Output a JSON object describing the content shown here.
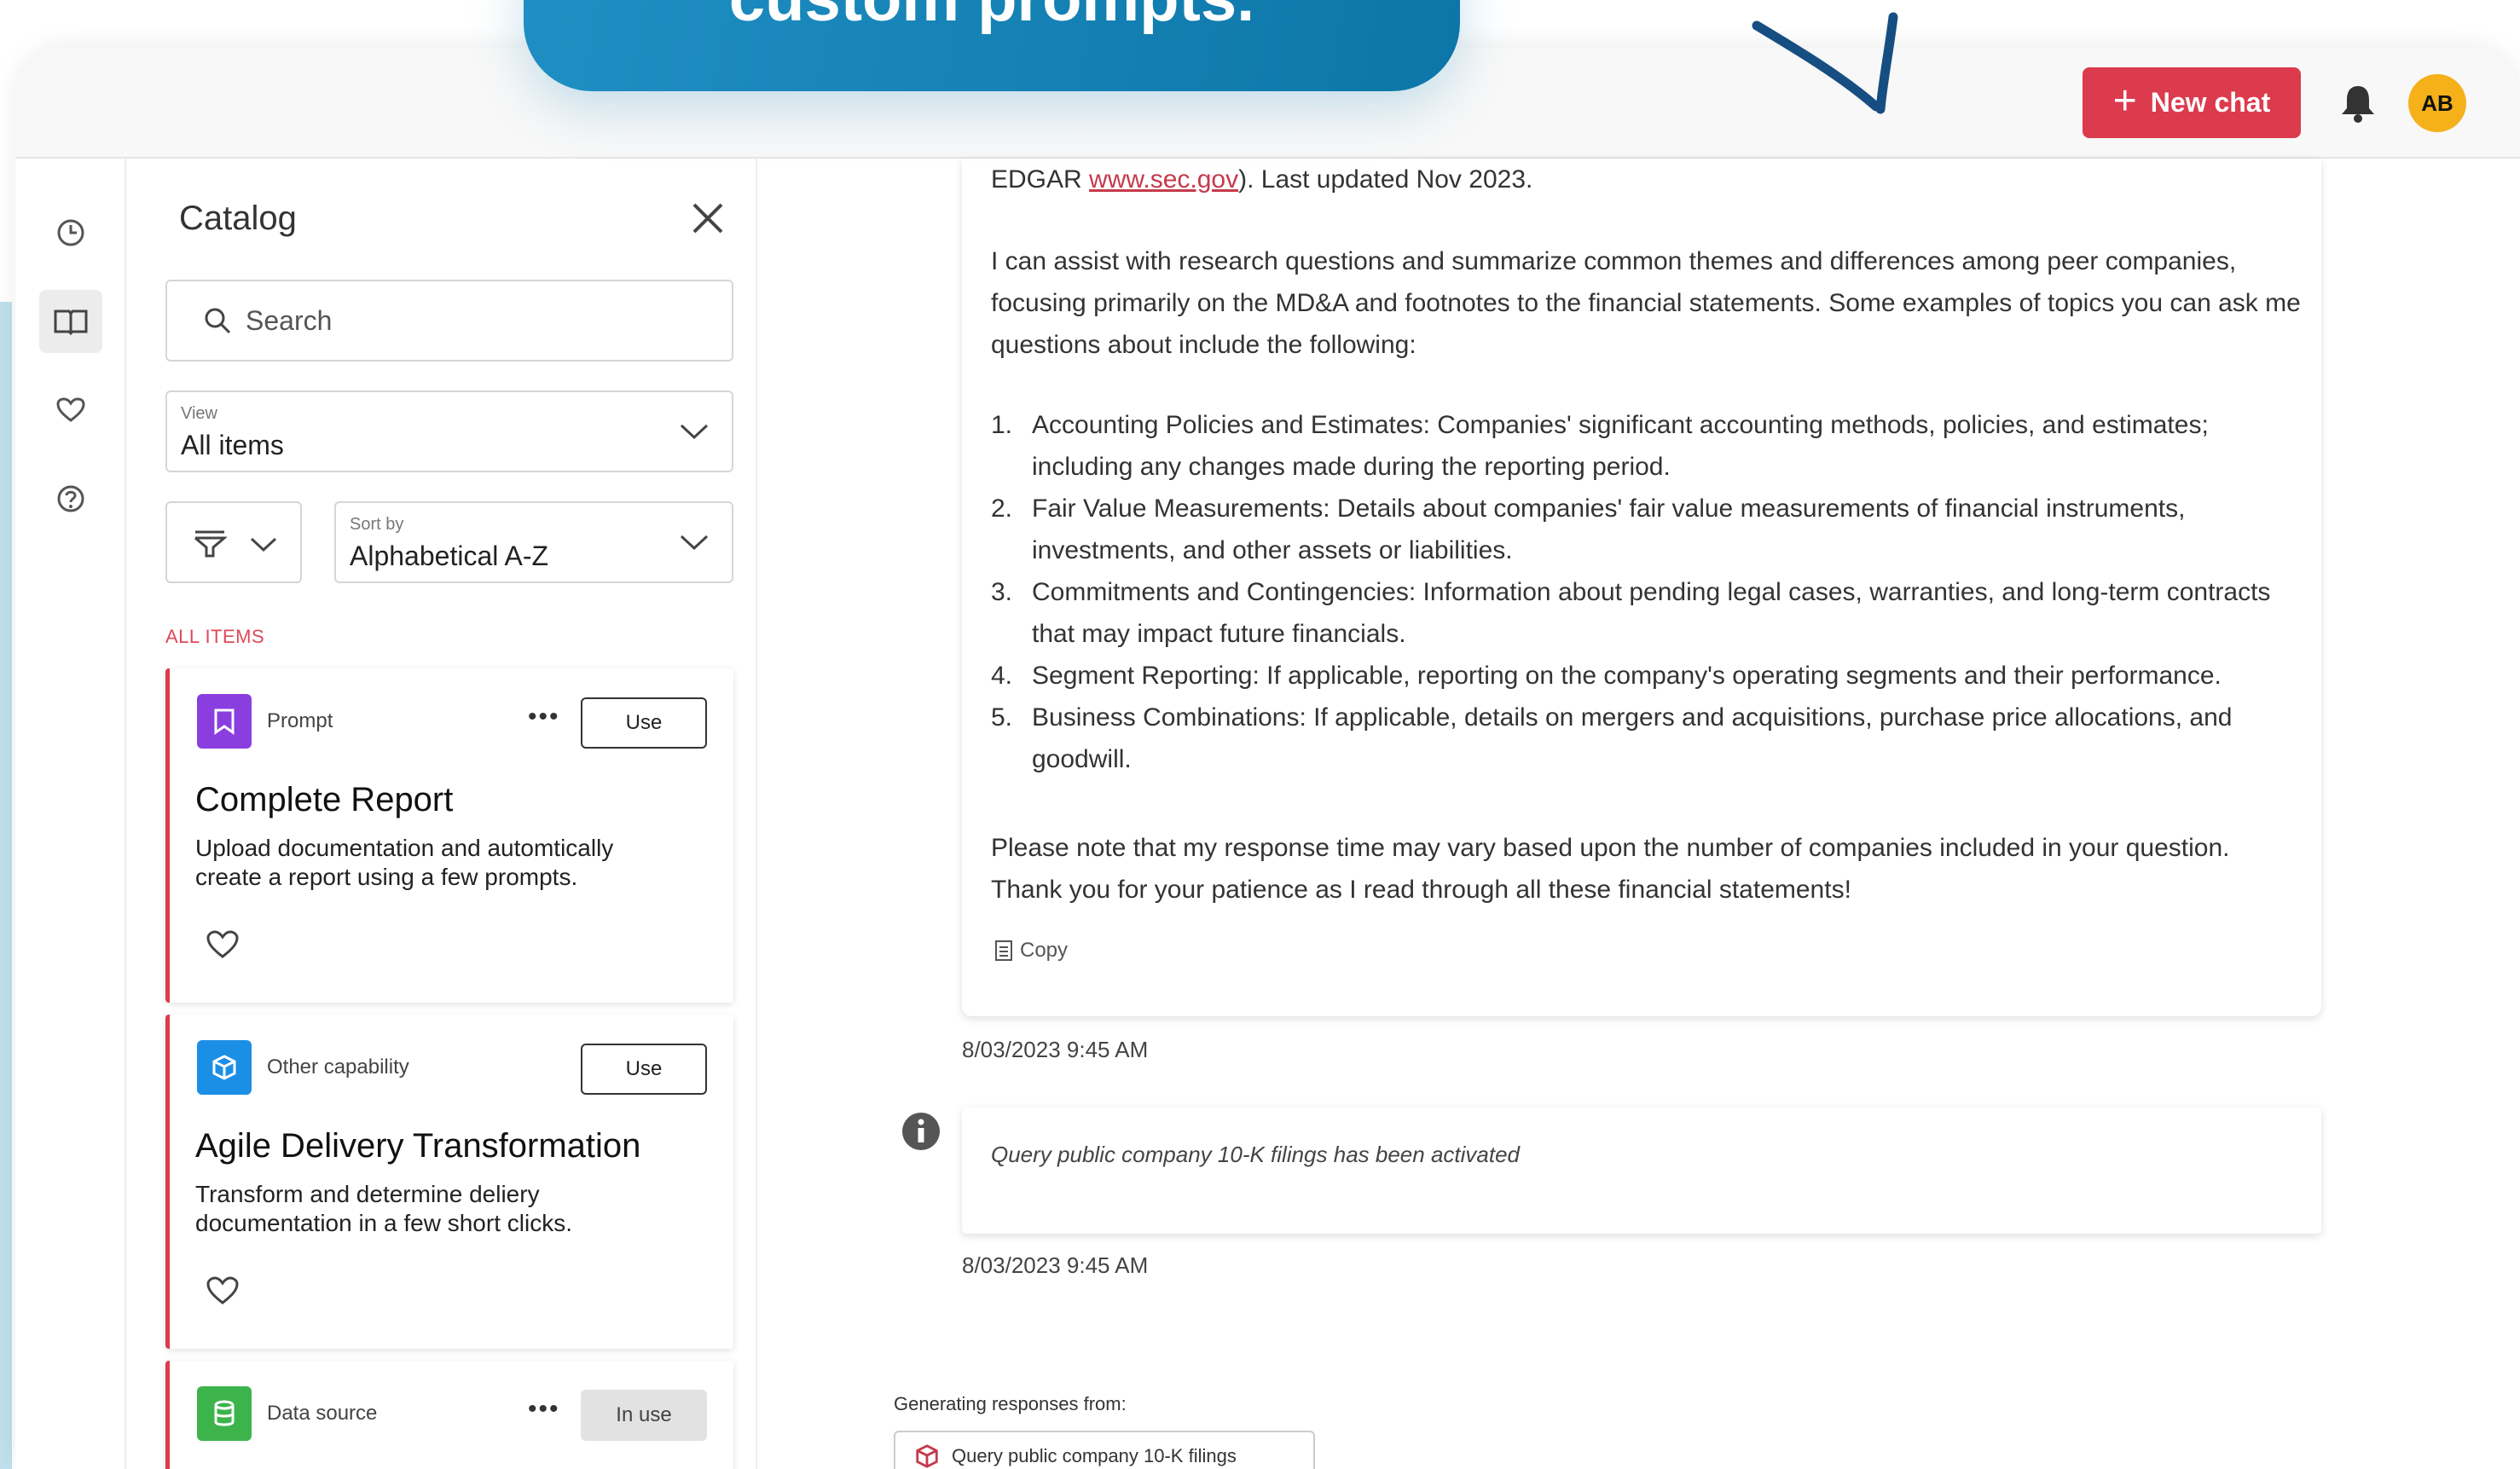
{
  "banner": {
    "text": "custom prompts."
  },
  "header": {
    "new_chat_label": "New chat",
    "avatar_initials": "AB"
  },
  "rail": {
    "items": [
      "history",
      "catalog",
      "favorites",
      "help"
    ]
  },
  "catalog": {
    "title": "Catalog",
    "search_placeholder": "Search",
    "view": {
      "label": "View",
      "value": "All items"
    },
    "sort": {
      "label": "Sort by",
      "value": "Alphabetical A-Z"
    },
    "section_label": "ALL ITEMS",
    "cards": [
      {
        "type": "Prompt",
        "title": "Complete Report",
        "description": "Upload documentation and automtically create a report using a few prompts.",
        "action": "Use",
        "color": "#8a3ee0"
      },
      {
        "type": "Other capability",
        "title": "Agile Delivery Transformation",
        "description": "Transform and determine deliery documentation in a few short clicks.",
        "action": "Use",
        "color": "#1b8fe6"
      },
      {
        "type": "Data source",
        "title": "",
        "description": "",
        "action": "In use",
        "color": "#3cb44b"
      }
    ]
  },
  "chat": {
    "intro_prefix": "EDGAR ",
    "intro_link": "www.sec.gov",
    "intro_suffix": "). Last updated Nov 2023.",
    "para1": "I can assist with research questions and summarize common themes and differences among peer companies, focusing primarily on the MD&A and footnotes to the financial statements. Some examples of topics you can ask me questions about include the following:",
    "list": [
      "Accounting Policies and Estimates: Companies' significant accounting methods, policies, and estimates; including any changes made during the reporting period.",
      "Fair Value Measurements: Details about companies' fair value measurements of financial instruments, investments, and other assets or liabilities.",
      "Commitments and Contingencies: Information about pending legal cases, warranties, and long-term contracts that may impact future financials.",
      "Segment Reporting: If applicable, reporting on the company's operating segments and their performance.",
      "Business Combinations: If applicable, details on mergers and acquisitions, purchase price allocations, and goodwill."
    ],
    "para2": "Please note that my response time may vary based upon the number of companies included in your question. Thank you for your patience as I read through all these financial statements!",
    "copy_label": "Copy",
    "timestamp1": "8/03/2023 9:45 AM",
    "system_msg": "Query public company 10-K filings has been activated",
    "timestamp2": "8/03/2023 9:45 AM",
    "generating_label": "Generating responses from:",
    "source_chip": "Query public company 10-K filings"
  }
}
